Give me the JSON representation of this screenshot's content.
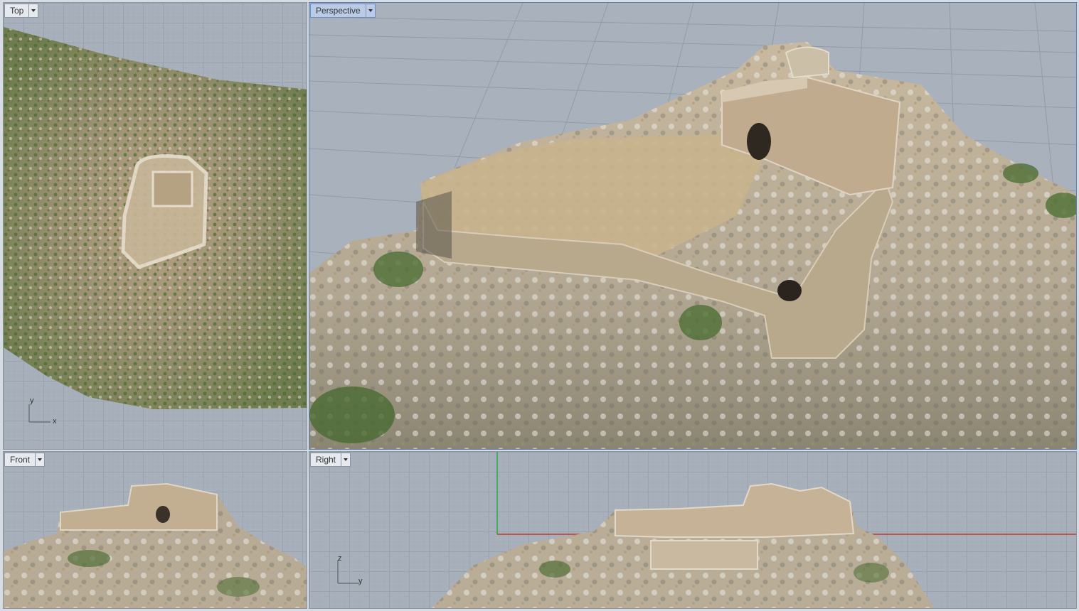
{
  "viewports": {
    "top": {
      "label": "Top",
      "axis_a": "y",
      "axis_b": "x"
    },
    "perspective": {
      "label": "Perspective"
    },
    "front": {
      "label": "Front"
    },
    "right": {
      "label": "Right",
      "axis_a": "z",
      "axis_b": "y"
    }
  },
  "colors": {
    "viewport_bg": "#a8b0bb",
    "active_border": "#5d7fb8",
    "axis_x": "#c0392b",
    "axis_y": "#27a845"
  }
}
